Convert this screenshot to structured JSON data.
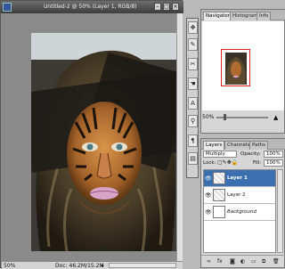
{
  "document": {
    "title": "Untitled-2 @ 50% (Layer 1, RGB/8)",
    "zoom": "50%",
    "doc_info": "Doc: 46.2M/15.2M"
  },
  "tools": {
    "icons": [
      "move-icon",
      "brush-icon",
      "eraser-icon",
      "hand-icon",
      "type-icon",
      "zoom-icon"
    ]
  },
  "navigator": {
    "tabs": [
      "Navigator",
      "Histogram",
      "Info"
    ],
    "zoom": "50%",
    "frame_color": "#e02020"
  },
  "layers": {
    "tabs": [
      "Layers",
      "Channels",
      "Paths"
    ],
    "blend_mode": "Multiply",
    "opacity_label": "Opacity:",
    "opacity": "100%",
    "lock_label": "Lock:",
    "fill_label": "Fill:",
    "fill": "100%",
    "items": [
      {
        "name": "Layer 1",
        "selected": true
      },
      {
        "name": "Layer 2",
        "selected": false
      },
      {
        "name": "Background",
        "selected": false
      }
    ],
    "footer_icons": [
      "link-icon",
      "fx-icon",
      "mask-icon",
      "adjustment-icon",
      "folder-icon",
      "new-layer-icon",
      "trash-icon"
    ],
    "selected_color": "#3b6fb0"
  }
}
